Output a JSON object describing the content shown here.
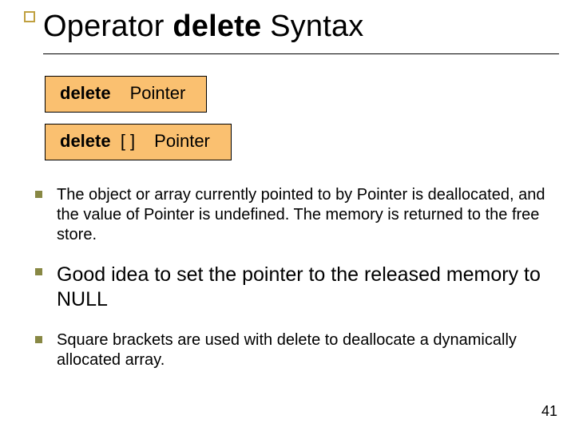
{
  "title": {
    "pre": "Operator ",
    "bold": "delete",
    "post": " Syntax"
  },
  "syntax": {
    "box1": {
      "kw": "delete",
      "rest": "Pointer"
    },
    "box2": {
      "kw": "delete",
      "mid": "[ ]",
      "rest": "Pointer"
    }
  },
  "bullets": [
    {
      "size": "sm",
      "text": "The object or array currently pointed to by Pointer is deallocated, and the value of Pointer is undefined.  The memory is returned to the free store."
    },
    {
      "size": "lg",
      "text": "Good idea to set the pointer to the released memory to NULL"
    },
    {
      "size": "sm",
      "text": "Square brackets are used with delete to deallocate a dynamically allocated array."
    }
  ],
  "pageNumber": "41"
}
